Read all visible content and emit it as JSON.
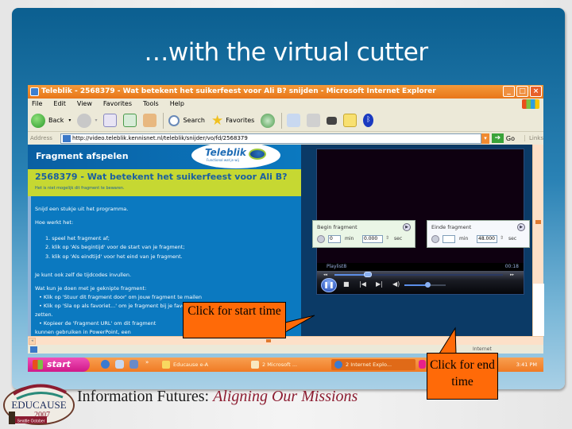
{
  "slide": {
    "title": "…with the virtual cutter"
  },
  "browser": {
    "title": "Teleblik - 2568379 - Wat betekent het suikerfeest voor Ali B? snijden - Microsoft Internet Explorer",
    "window_buttons": [
      "_",
      "□",
      "×"
    ],
    "menu": [
      "File",
      "Edit",
      "View",
      "Favorites",
      "Tools",
      "Help"
    ],
    "toolbar": {
      "back": "Back",
      "search": "Search",
      "favorites": "Favorites"
    },
    "address": {
      "label": "Address",
      "url": "http://video.teleblik.kennisnet.nl/teleblik/snijder/vo/fd/2568379",
      "go": "Go",
      "links": "Links"
    },
    "status": {
      "zone": "Internet"
    }
  },
  "page": {
    "header_title": "Fragment afspelen",
    "logo_text": "Teleblik",
    "logo_sub": "Functional wat je wij",
    "fragment_title": "2568379 - Wat betekent het suikerfeest voor Ali B?",
    "fragment_sub": "Het is niet mogelijk dit fragment te bewaren.",
    "step_intro": "Snijd een stukje uit het programma.",
    "how_title": "Hoe werkt het:",
    "steps": [
      "1.   speel het fragment af;",
      "2.   klik op 'Als begintijd' voor de start van je fragment;",
      "3.   klik op 'Als eindtijd' voor het eind van je fragment."
    ],
    "manual_note": "Je kunt ook zelf de tijdcodes invullen.",
    "what_title": "Wat kun je doen met je geknipte fragment:",
    "bullets": [
      "• Klik op 'Stuur dit fragment door' om jouw fragment te mailen",
      "• Klik op 'Sla op als favoriet...' om je fragment bij je favorieten te",
      "zetten.",
      "• Kopieer de 'Fragment URL' om dit fragment",
      "kunnen gebruiken in PowerPoint, een"
    ]
  },
  "player": {
    "status": "Playlist8",
    "time": "00:18",
    "seek_fraction": 0.2,
    "volume_fraction": 0.55
  },
  "fragment_begin": {
    "title": "Begin fragment",
    "min_value": "0",
    "min_label": "min",
    "sec_value": "0.000",
    "sec_label": "sec"
  },
  "fragment_end": {
    "title": "Einde fragment",
    "min_value": "",
    "min_label": "min",
    "sec_value": "48.000",
    "sec_label": "sec"
  },
  "taskbar": {
    "start": "start",
    "tasks": [
      "Educause e-A",
      "2 Microsoft ...",
      "2 Internet Explo..."
    ],
    "clock": "3:41 PM"
  },
  "callouts": {
    "start": "Click for start time",
    "end": "Click for end time"
  },
  "footer": {
    "prefix": "Information Futures:",
    "emphasis": "Aligning Our Missions",
    "logo_name": "EDUCAUSE",
    "logo_year": "2007",
    "logo_city": "Seattle October"
  },
  "colors": {
    "callout": "#ff6a08",
    "xp_orange": "#f07a24",
    "page_blue": "#0b79c0",
    "band_yellow": "#c6d832",
    "footer_accent": "#8c1c30"
  }
}
